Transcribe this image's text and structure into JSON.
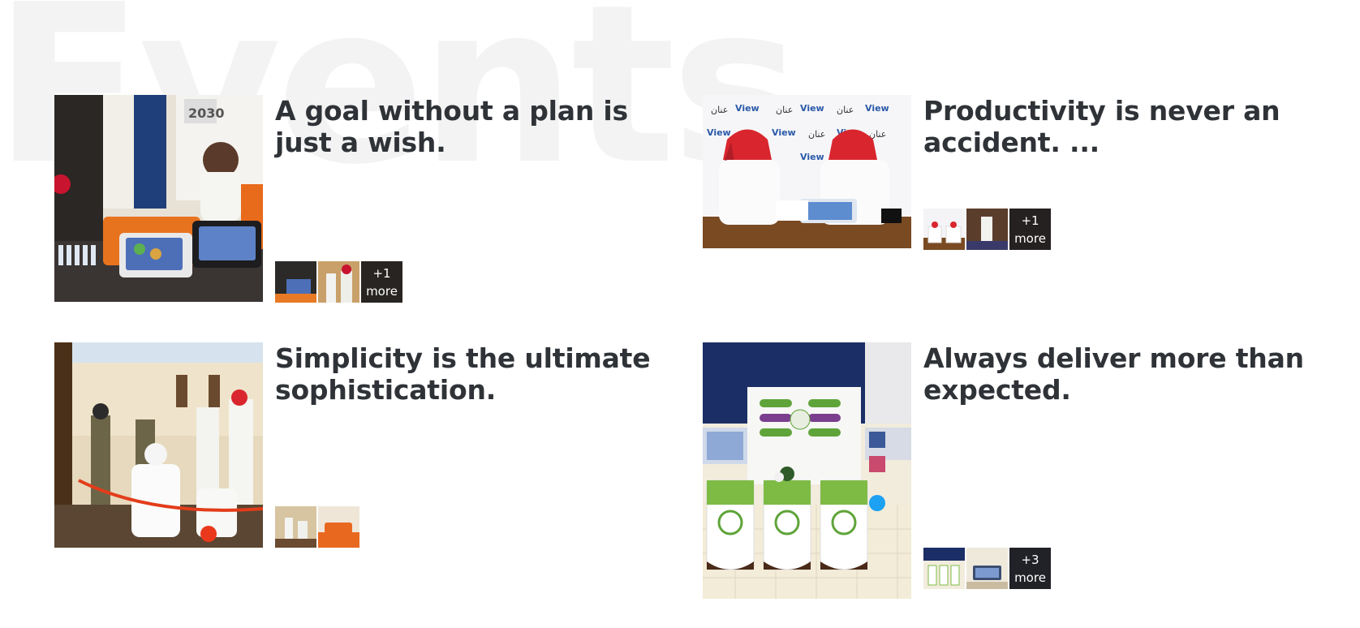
{
  "section": {
    "background_word": "Events"
  },
  "events": [
    {
      "title": "A goal without a plan is just a wish.",
      "image_alt": "Exhibition booth with tablets and a presenter in a white outfit",
      "more_count": "+1",
      "more_label": "more"
    },
    {
      "title": "Productivity is never an accident. ...",
      "image_alt": "Two men signing documents in front of a View Plus branded backdrop",
      "more_count": "+1",
      "more_label": "more"
    },
    {
      "title": "Simplicity is the ultimate sophistication.",
      "image_alt": "Ribbon cutting ceremony in an ornate hall"
    },
    {
      "title": "Always deliver more than expected.",
      "image_alt": "Kayan exhibition stand with display panels and tablets",
      "more_count": "+3",
      "more_label": "more"
    }
  ]
}
